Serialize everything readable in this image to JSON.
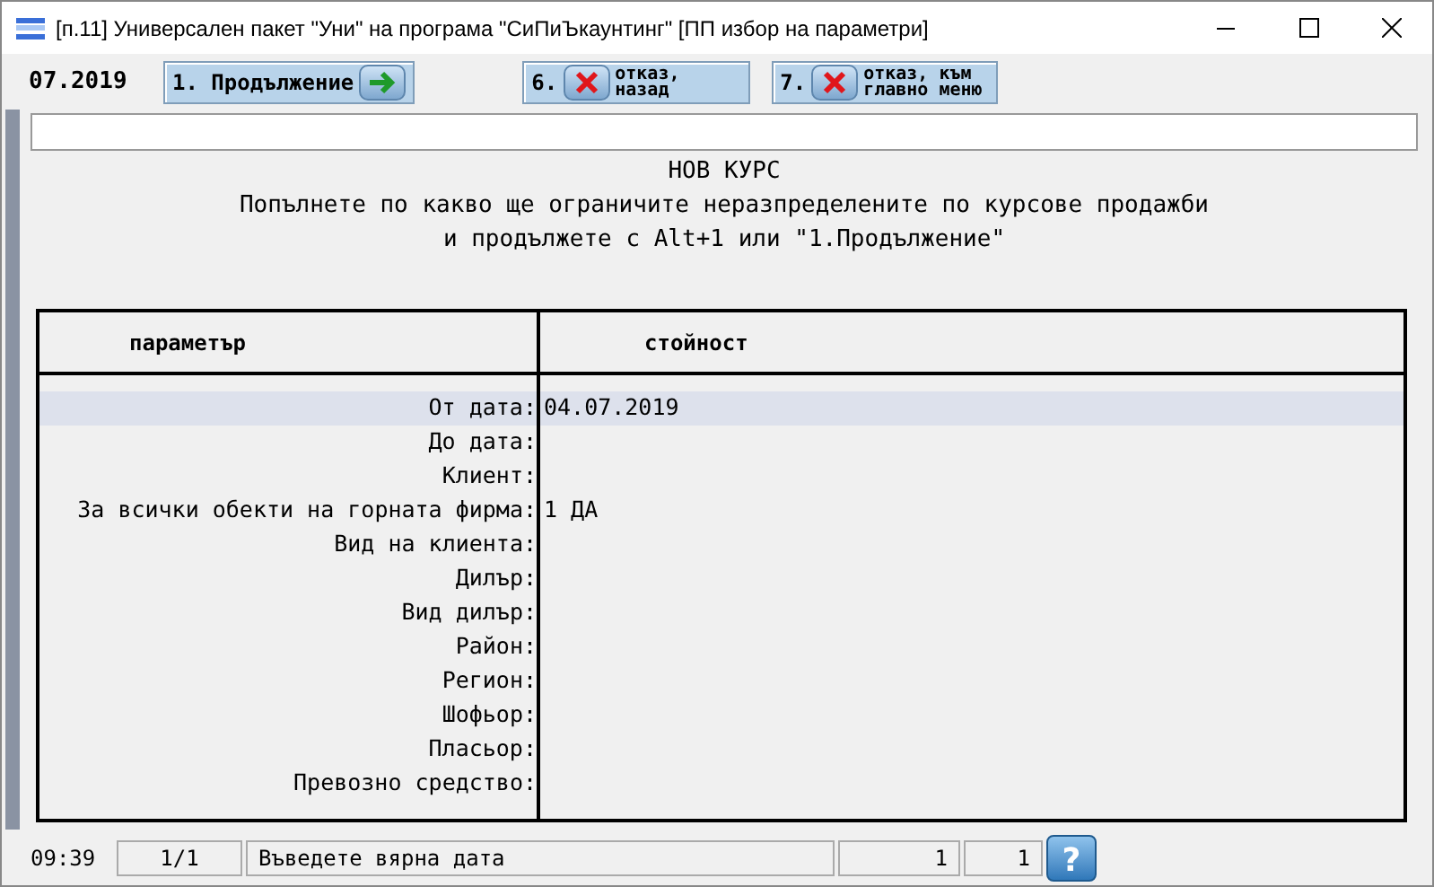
{
  "window": {
    "title": "[п.11] Универсален пакет \"Уни\" на програма \"СиПиЪкаунтинг\" [ПП избор на параметри]"
  },
  "toolbar": {
    "period": "07.2019",
    "buttons": [
      {
        "key": "1.",
        "label": "Продължение",
        "kind": "forward"
      },
      {
        "key": "6.",
        "label": "отказ, назад",
        "kind": "cancel"
      },
      {
        "key": "7.",
        "label": "отказ, към главно меню",
        "kind": "cancel"
      }
    ]
  },
  "heading": {
    "title": "НОВ КУРС",
    "lines": [
      "Попълнете по какво ще ограничите неразпределените по курсове продажби",
      "и продължете с Alt+1 или \"1.Продължение\""
    ]
  },
  "table": {
    "columns": [
      "параметър",
      "стойност"
    ],
    "rows": [
      {
        "parameter": "От дата:",
        "value": "04.07.2019",
        "selected": true
      },
      {
        "parameter": "До дата:",
        "selected": false
      },
      {
        "parameter": "Клиент:",
        "selected": false
      },
      {
        "parameter": "За всички обекти на горната фирма:",
        "value": "1 ДА",
        "selected": false
      },
      {
        "parameter": "Вид на клиента:",
        "selected": false
      },
      {
        "parameter": "Дилър:",
        "selected": false
      },
      {
        "parameter": "Вид дилър:",
        "selected": false
      },
      {
        "parameter": "Район:",
        "selected": false
      },
      {
        "parameter": "Регион:",
        "selected": false
      },
      {
        "parameter": "Шофьор:",
        "selected": false
      },
      {
        "parameter": "Пласьор:",
        "selected": false
      },
      {
        "parameter": "Превозно средство:",
        "selected": false
      }
    ]
  },
  "status_bar": {
    "time": "09:39",
    "page": "1/1",
    "message": "Въведете вярна дата",
    "field_1": "1",
    "field_2": "1",
    "help_icon": "?"
  }
}
